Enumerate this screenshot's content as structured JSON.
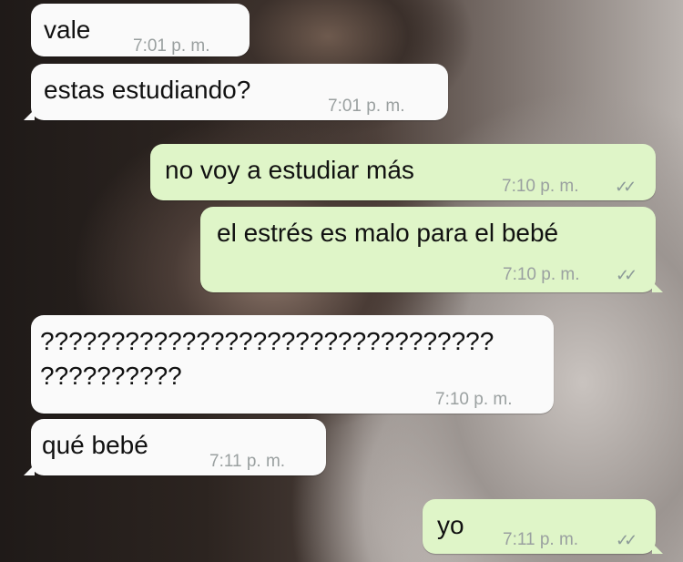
{
  "messages": [
    {
      "direction": "incoming",
      "text": "vale",
      "time": "7:01 p. m."
    },
    {
      "direction": "incoming",
      "text": "estas estudiando?",
      "time": "7:01 p. m."
    },
    {
      "direction": "outgoing",
      "text": "no voy a estudiar más",
      "time": "7:10 p. m.",
      "status_icon": "double-check-icon"
    },
    {
      "direction": "outgoing",
      "text": "el estrés es malo para el bebé",
      "time": "7:10 p. m.",
      "status_icon": "double-check-icon"
    },
    {
      "direction": "incoming",
      "text_lines": [
        "????????????????????????????????",
        "??????????"
      ],
      "time": "7:10 p. m."
    },
    {
      "direction": "incoming",
      "text": "qué bebé",
      "time": "7:11 p. m."
    },
    {
      "direction": "outgoing",
      "text": "yo",
      "time": "7:11 p. m.",
      "status_icon": "double-check-icon"
    }
  ],
  "colors": {
    "incoming_bubble": "#fafafa",
    "outgoing_bubble": "#dff5c8",
    "timestamp": "#9aa0a0"
  }
}
